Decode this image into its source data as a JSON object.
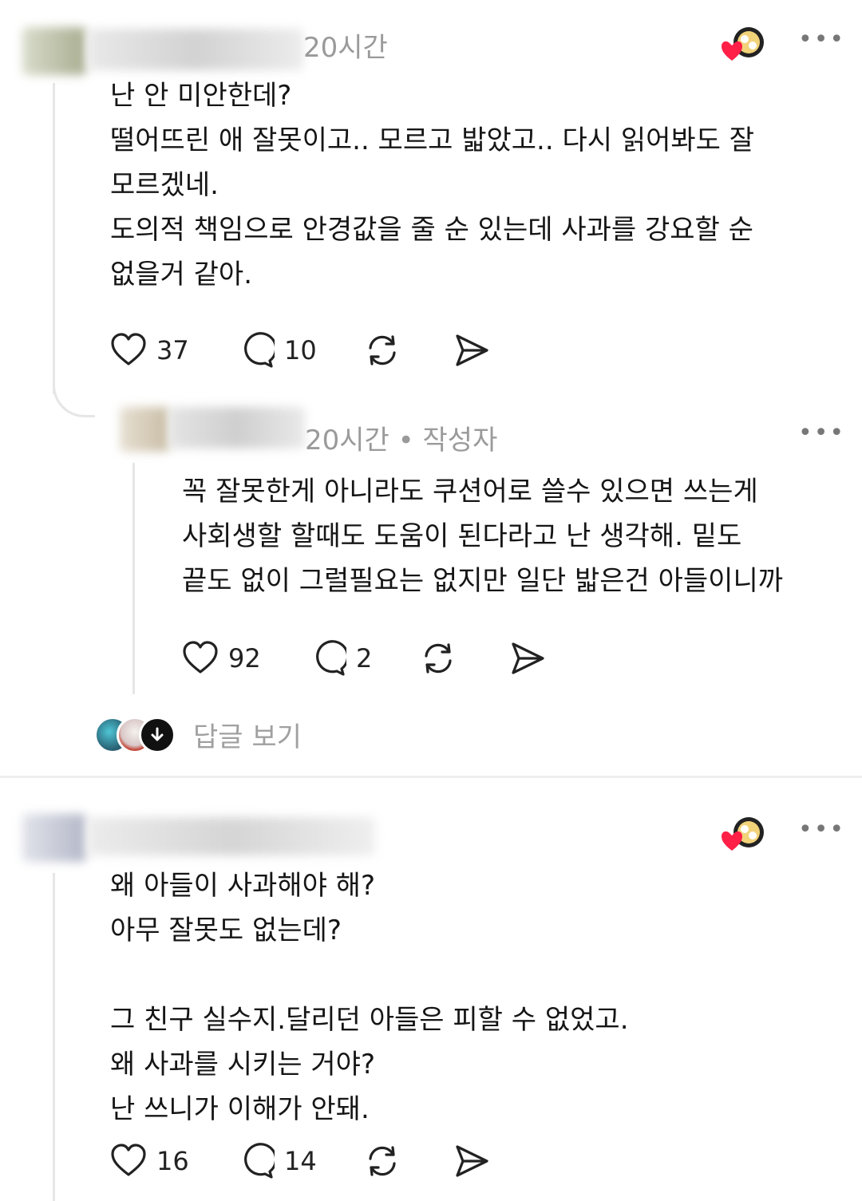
{
  "comments": [
    {
      "time": "20시간",
      "author_tag": "",
      "text": "난 안 미안한데?\n떨어뜨린 애 잘못이고.. 모르고 밟았고.. 다시 읽어봐도 잘\n모르겠네.\n도의적 책임으로 안경값을 줄 순 있는데 사과를 강요할 순\n없을거 같아.",
      "likes": "37",
      "replies": "10"
    },
    {
      "time": "20시간",
      "author_tag": "작성자",
      "text": "꼭 잘못한게 아니라도 쿠션어로 쓸수 있으면 쓰는게\n사회생할 할때도 도움이 된다라고 난 생각해. 밑도\n끝도 없이 그럴필요는 없지만 일단 밟은건 아들이니까",
      "likes": "92",
      "replies": "2"
    },
    {
      "time": "",
      "author_tag": "",
      "text": "왜 아들이 사과해야 해?\n아무 잘못도 없는데?\n\n그 친구 실수지.달리던 아들은 피할 수 없었고.\n왜 사과를 시키는 거야?\n난 쓰니가 이해가 안돼.",
      "likes": "16",
      "replies": "14"
    }
  ],
  "view_replies_label": "답글 보기",
  "more_label": "•••",
  "dot": "•",
  "colors": {
    "heart": "#ff1f47",
    "meta": "#9a9a9a",
    "divider": "#efefef"
  },
  "icons": [
    "heart-icon",
    "comment-icon",
    "repost-icon",
    "share-icon",
    "more-icon",
    "arrow-down-icon"
  ]
}
